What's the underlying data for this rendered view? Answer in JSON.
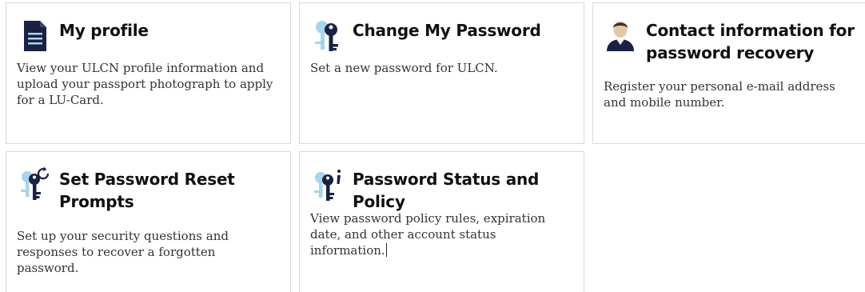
{
  "cards": [
    {
      "title": "My profile",
      "description": "View your ULCN profile information and upload your passport photograph to apply for a LU-Card.",
      "icon": "document-icon"
    },
    {
      "title": "Change My Password",
      "description": "Set a new password for ULCN.",
      "icon": "keys-icon"
    },
    {
      "title": "Contact information for password recovery",
      "description": "Register your personal e-mail address and mobile number.",
      "icon": "person-icon"
    },
    {
      "title": "Set Password Reset Prompts",
      "description": "Set up your security questions and responses to recover a forgotten password.",
      "icon": "keys-reset-icon"
    },
    {
      "title": "Password Status and Policy",
      "description": "View password policy rules, expiration date, and other account status information.",
      "icon": "keys-info-icon"
    }
  ],
  "colors": {
    "icon_dark": "#1a2142",
    "icon_light": "#a9d4ea",
    "border": "#d9d9d9"
  }
}
